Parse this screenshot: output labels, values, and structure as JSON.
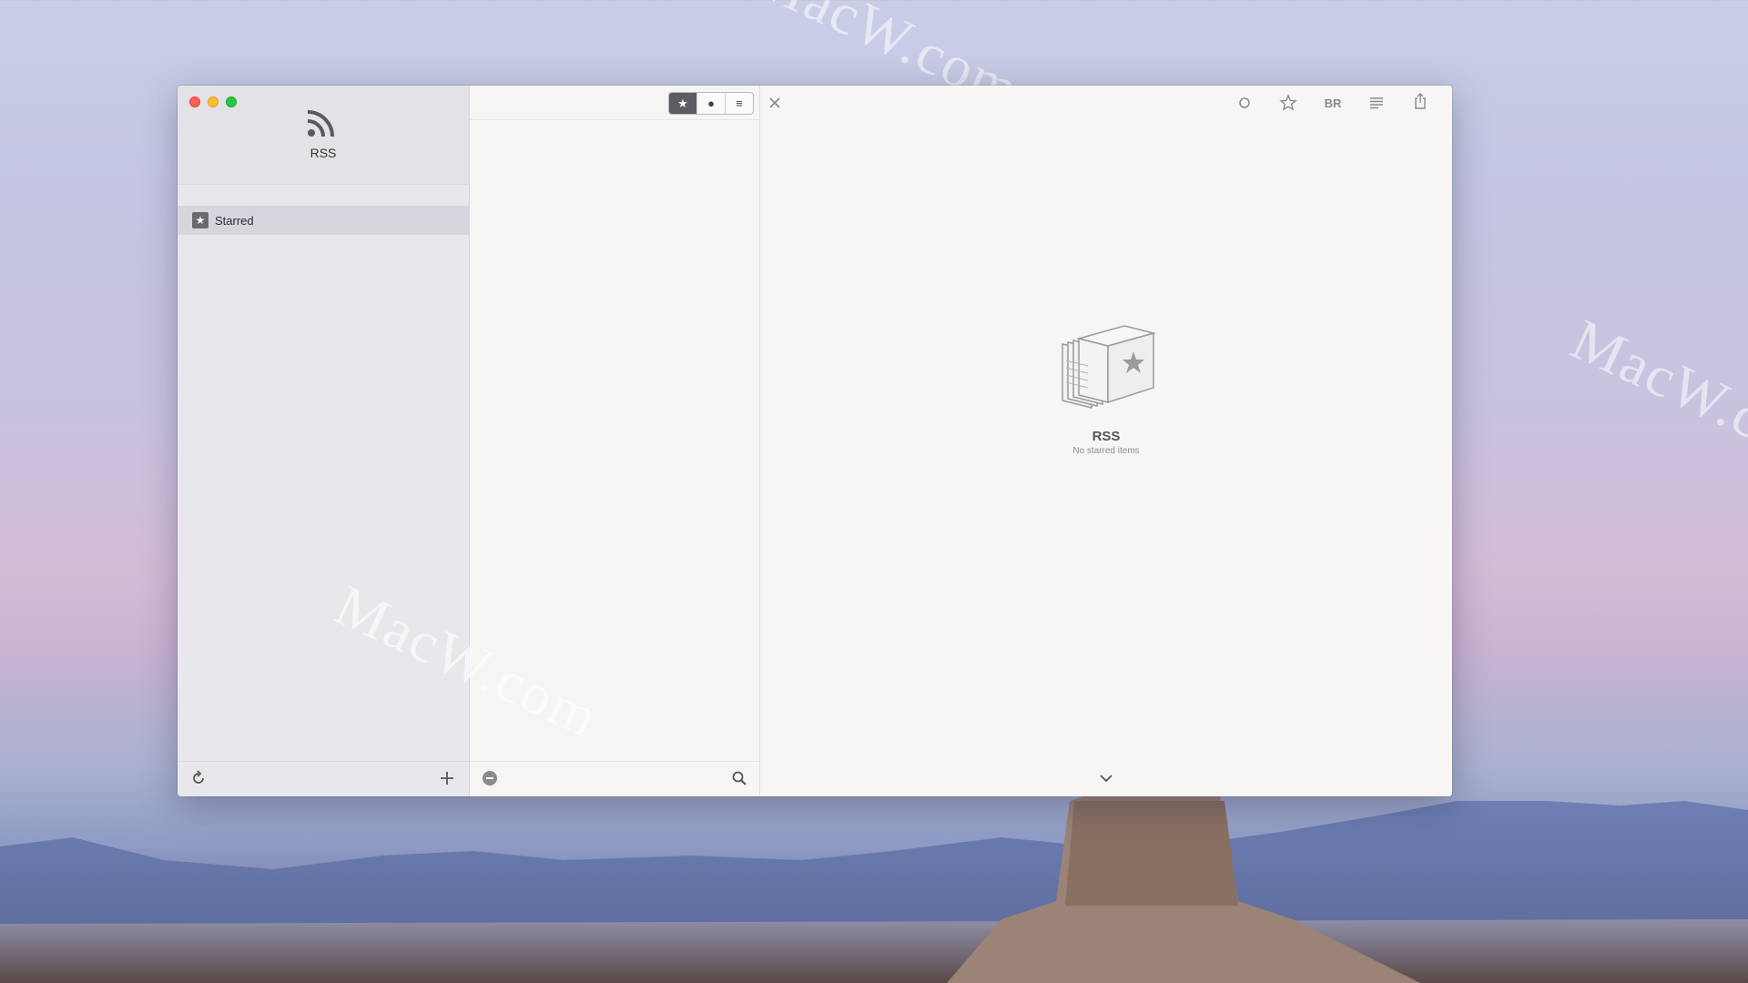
{
  "app": {
    "name": "RSS"
  },
  "sidebar": {
    "items": [
      {
        "label": "Starred",
        "icon": "star-icon",
        "selected": true
      }
    ],
    "footer": {
      "left_icon": "refresh-icon",
      "right_icon": "plus-icon"
    }
  },
  "list": {
    "filters": [
      {
        "icon": "star-icon",
        "glyph": "★",
        "active": true
      },
      {
        "icon": "dot-icon",
        "glyph": "●",
        "active": false
      },
      {
        "icon": "lines-icon",
        "glyph": "≡",
        "active": false
      }
    ],
    "footer": {
      "left_icon": "minus-circle-icon",
      "right_icon": "search-icon"
    }
  },
  "reader": {
    "toolbar_icons": [
      "close-icon",
      "circle-icon",
      "star-outline-icon",
      "br-icon",
      "list-icon",
      "share-icon"
    ],
    "br_label": "BR",
    "empty_title": "RSS",
    "empty_subtitle": "No starred items"
  },
  "desktop": {
    "watermarks": [
      "MacW.com",
      "MacW.com",
      "MacW.c"
    ]
  },
  "colors": {
    "window_bg": "#f7f6f4",
    "sidebar_bg": "#e8e7ec",
    "selected_row": "#d7d6de",
    "active_segment": "#5d5c61"
  }
}
